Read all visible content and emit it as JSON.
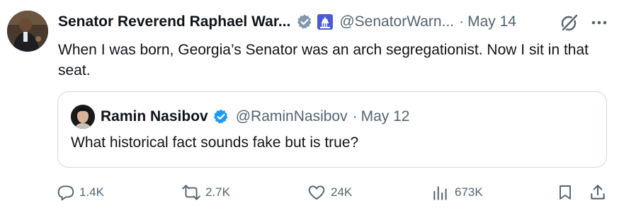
{
  "tweet": {
    "author_name": "Senator Reverend Raphael War...",
    "handle": "@SenatorWarn...",
    "separator": "·",
    "date": "May 14",
    "text": "When I was born, Georgia’s Senator was an arch segregationist. Now I sit in that seat."
  },
  "quoted": {
    "author_name": "Ramin Nasibov",
    "handle": "@RaminNasibov",
    "separator": "·",
    "date": "May 12",
    "text": "What historical fact sounds fake but is true?"
  },
  "actions": {
    "replies": "1.4K",
    "reposts": "2.7K",
    "likes": "24K",
    "views": "673K"
  },
  "icons": {
    "verified": "verified-badge-icon",
    "affiliation": "capitol-affiliation-icon",
    "grok": "grok-icon",
    "more": "more-icon",
    "reply": "reply-icon",
    "repost": "repost-icon",
    "like": "heart-icon",
    "views": "views-chart-icon",
    "bookmark": "bookmark-icon",
    "share": "share-icon"
  },
  "colors": {
    "accent": "#1d9bf0",
    "muted": "#536471",
    "verified_gray": "#829aab",
    "text": "#0f1419",
    "border": "#cfd9de"
  }
}
